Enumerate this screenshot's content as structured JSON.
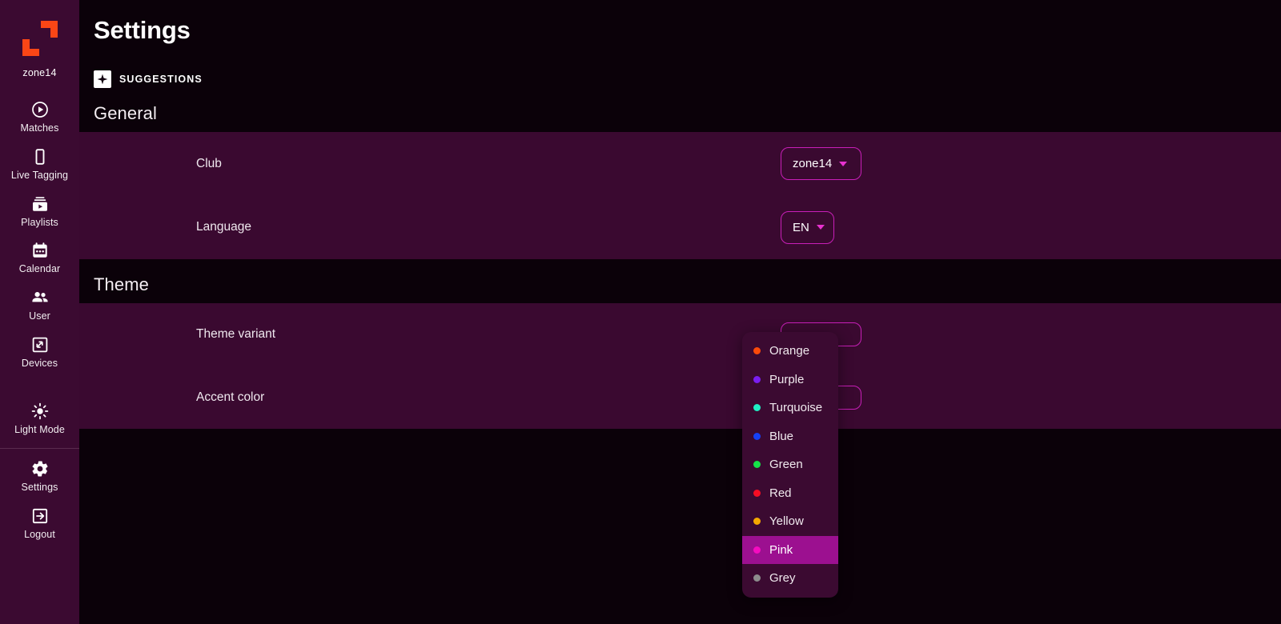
{
  "app": {
    "brand": "zone14",
    "logo_color": "#fa4616"
  },
  "sidebar": {
    "items": [
      {
        "label": "Matches",
        "icon": "play-circle-icon"
      },
      {
        "label": "Live Tagging",
        "icon": "mobile-icon"
      },
      {
        "label": "Playlists",
        "icon": "video-library-icon"
      },
      {
        "label": "Calendar",
        "icon": "calendar-icon"
      },
      {
        "label": "User",
        "icon": "people-icon"
      },
      {
        "label": "Devices",
        "icon": "devices-icon"
      },
      {
        "label": "Light Mode",
        "icon": "sun-icon"
      },
      {
        "label": "Settings",
        "icon": "gear-icon"
      },
      {
        "label": "Logout",
        "icon": "logout-icon"
      }
    ]
  },
  "header": {
    "title": "Settings",
    "suggestions_label": "SUGGESTIONS",
    "suggestions_icon": "sparkle-icon"
  },
  "sections": [
    {
      "title": "General",
      "rows": [
        {
          "label": "Club",
          "value": "zone14"
        },
        {
          "label": "Language",
          "value": "EN"
        }
      ]
    },
    {
      "title": "Theme",
      "rows": [
        {
          "label": "Theme variant",
          "value": ""
        },
        {
          "label": "Accent color",
          "value": ""
        }
      ]
    }
  ],
  "accent_menu": {
    "open": true,
    "selected": "Pink",
    "options": [
      {
        "label": "Orange",
        "color": "#fb4a0a"
      },
      {
        "label": "Purple",
        "color": "#7a1ef0"
      },
      {
        "label": "Turquoise",
        "color": "#1ff0c4"
      },
      {
        "label": "Blue",
        "color": "#1540f5"
      },
      {
        "label": "Green",
        "color": "#14e248"
      },
      {
        "label": "Red",
        "color": "#f50d23"
      },
      {
        "label": "Yellow",
        "color": "#f4a800"
      },
      {
        "label": "Pink",
        "color": "#f50cc0"
      },
      {
        "label": "Grey",
        "color": "#8c8c8c"
      }
    ]
  },
  "theme": {
    "page_bg": "#0b0109",
    "sidebar_bg": "#3b0a31",
    "panel_bg": "#3a0930",
    "accent": "#c81fb8",
    "highlight": "#9c1090"
  }
}
